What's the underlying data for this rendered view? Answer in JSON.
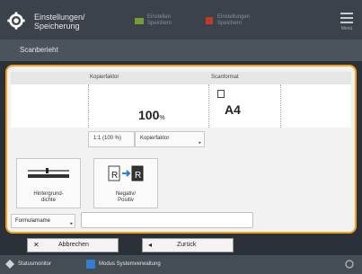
{
  "header": {
    "title": "Einstellungen/\nSpeicherung",
    "btn1": "Einstellen\nSpeichern",
    "btn2": "Einstellungen\nSpeichern",
    "menu_label": "Menü"
  },
  "subheader": {
    "title": "Scanberieht"
  },
  "panel": {
    "col1_label": "Kopierfaktor",
    "col2_label": "Scanformat",
    "zoom_value": "100",
    "zoom_unit": "%",
    "paper_value": "A4",
    "tab1_label": "1:1 (100 %)",
    "tab2_label": "Kopierfaktor",
    "btn_density_label": "Hintergrund-\ndichte",
    "btn_negpos_label": "Negativ/\nPositiv",
    "form_label": "Formularname",
    "form_value": ""
  },
  "actions": {
    "cancel": "Abbrechen",
    "back": "Zurück"
  },
  "footer": {
    "left": "Statusmonitor",
    "right": "Modus Systemverwaltung"
  },
  "colors": {
    "accent": "#f2a11c",
    "header_bg": "#3b4249",
    "footer_icon": "#2f80d0"
  }
}
